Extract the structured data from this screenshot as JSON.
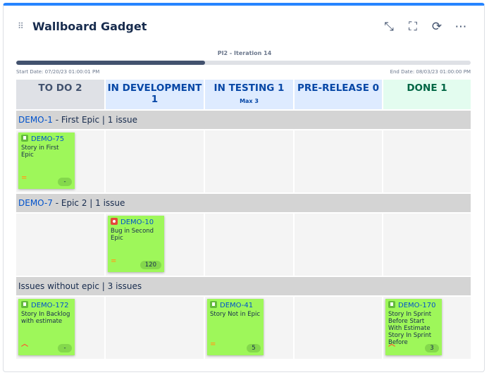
{
  "gadget": {
    "title": "Wallboard Gadget",
    "drag_handle": "⠿",
    "tools": [
      {
        "name": "collapse-icon",
        "glyph": "⤡"
      },
      {
        "name": "fullscreen-icon",
        "glyph": "⛶"
      },
      {
        "name": "refresh-icon",
        "glyph": "⟳"
      },
      {
        "name": "more-icon",
        "glyph": "⋯"
      }
    ]
  },
  "sprint": {
    "name": "PI2 - Iteration 14",
    "progress_percent": 41.5,
    "start": "Start Date: 07/20/23 01:00:01 PM",
    "end": "End Date: 08/03/23 01:00:00 PM"
  },
  "columns": [
    {
      "label": "TO DO 2",
      "bg": "#dfe1e6",
      "color": "#42526e",
      "sub": ""
    },
    {
      "label": "IN DEVELOPMENT 1",
      "bg": "#deebff",
      "color": "#0747a6",
      "sub": ""
    },
    {
      "label": "IN TESTING 1",
      "bg": "#deebff",
      "color": "#0747a6",
      "sub": "Max 3"
    },
    {
      "label": "PRE-RELEASE 0",
      "bg": "#deebff",
      "color": "#0747a6",
      "sub": ""
    },
    {
      "label": "DONE 1",
      "bg": "#e3fcef",
      "color": "#006644",
      "sub": ""
    }
  ],
  "groups": [
    {
      "key": "DEMO-1",
      "text": " - First Epic | 1 issue",
      "cards": [
        {
          "col": 0,
          "key": "DEMO-75",
          "type": "story",
          "summary": "Story in First Epic",
          "priority": "med",
          "estimate": "-"
        }
      ]
    },
    {
      "key": "DEMO-7",
      "text": " - Epic 2 | 1 issue",
      "cards": [
        {
          "col": 1,
          "key": "DEMO-10",
          "type": "bug",
          "summary": "Bug in Second Epic",
          "priority": "med",
          "estimate": "120"
        }
      ]
    },
    {
      "key": "",
      "text": "Issues without epic | 3 issues",
      "cards": [
        {
          "col": 0,
          "key": "DEMO-172",
          "type": "story",
          "summary": "Story In Backlog with estimate",
          "priority": "high",
          "estimate": "-"
        },
        {
          "col": 2,
          "key": "DEMO-41",
          "type": "story",
          "summary": "Story Not in Epic",
          "priority": "med",
          "estimate": "5"
        },
        {
          "col": 4,
          "key": "DEMO-170",
          "type": "story",
          "summary": "Story In Sprint Before Start With Estimate Story In Sprint Before",
          "priority": "high",
          "estimate": "3"
        }
      ]
    }
  ]
}
